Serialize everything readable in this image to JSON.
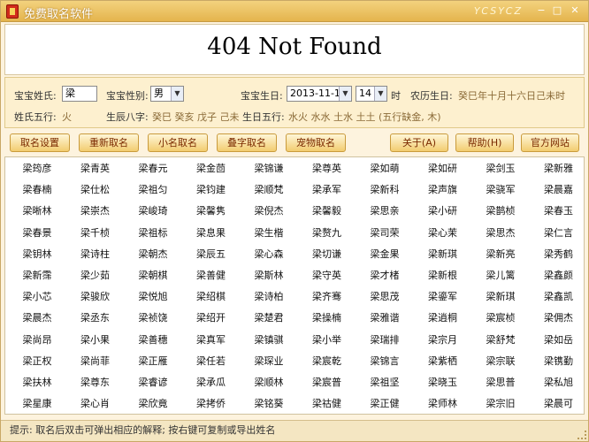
{
  "window": {
    "title": "免费取名软件",
    "brand": "YCSYCZ",
    "minimize": "−",
    "maximize": "□",
    "close": "✕"
  },
  "browser": {
    "message": "404 Not Found"
  },
  "form": {
    "surname_label": "宝宝姓氏:",
    "surname_value": "梁",
    "gender_label": "宝宝性别:",
    "gender_value": "男",
    "birthday_label": "宝宝生日:",
    "birthday_value": "2013-11-18",
    "hour_value": "14",
    "hour_suffix": "时",
    "lunar_label": "农历生日:",
    "lunar_value": "癸巳年十月十六日己未时",
    "surname_wuxing_label": "姓氏五行:",
    "surname_wuxing_value": "火",
    "bazi_label": "生辰八字:",
    "bazi_value": "癸巳 癸亥 戊子 己未",
    "day_wuxing_label": "生日五行:",
    "day_wuxing_value": "水火 水水 土水 土土 (五行缺金, 木)"
  },
  "toolbar": {
    "buttons": [
      "取名设置",
      "重新取名",
      "小名取名",
      "叠字取名",
      "宠物取名",
      "关于(A)",
      "帮助(H)",
      "官方网站"
    ]
  },
  "names": [
    [
      "梁筠彦",
      "梁青英",
      "梁春元",
      "梁金茴",
      "梁锦谦",
      "梁尊英",
      "梁如萌",
      "梁如研",
      "梁剑玉",
      "梁新雅"
    ],
    [
      "梁春楠",
      "梁仕松",
      "梁祖匀",
      "梁钧建",
      "梁顺梵",
      "梁承军",
      "梁新科",
      "梁声旗",
      "梁骁军",
      "梁晨嘉"
    ],
    [
      "梁晰林",
      "梁崇杰",
      "梁峻琦",
      "梁馨隽",
      "梁倪杰",
      "梁馨毅",
      "梁思亲",
      "梁小研",
      "梁鹊桢",
      "梁春玉"
    ],
    [
      "梁春景",
      "梁千桢",
      "梁祖标",
      "梁息果",
      "梁生楷",
      "梁赘九",
      "梁司荣",
      "梁心茉",
      "梁思杰",
      "梁仁言"
    ],
    [
      "梁钥林",
      "梁诗柱",
      "梁朝杰",
      "梁辰五",
      "梁心森",
      "梁切谦",
      "梁金果",
      "梁新琪",
      "梁新亮",
      "梁秀鹤"
    ],
    [
      "梁新霈",
      "梁少茹",
      "梁朝棋",
      "梁善健",
      "梁斯林",
      "梁守英",
      "梁才楮",
      "梁新根",
      "梁儿篱",
      "梁鑫颜"
    ],
    [
      "梁小芯",
      "梁骏欣",
      "梁悦旭",
      "梁绍棋",
      "梁诗柏",
      "梁齐骞",
      "梁思茂",
      "梁鎏军",
      "梁新琪",
      "梁鑫凯"
    ],
    [
      "梁晨杰",
      "梁丞东",
      "梁祯饶",
      "梁绍开",
      "梁楚君",
      "梁操楠",
      "梁雅谐",
      "梁逍桐",
      "梁宸桢",
      "梁佣杰"
    ],
    [
      "梁尚昂",
      "梁小果",
      "梁善穗",
      "梁真军",
      "梁镇骐",
      "梁小举",
      "梁瑞排",
      "梁宗月",
      "梁舒梵",
      "梁如岳"
    ],
    [
      "梁正权",
      "梁尚菲",
      "梁正雁",
      "梁任若",
      "梁琛业",
      "梁宸乾",
      "梁锦言",
      "梁紫栖",
      "梁宗联",
      "梁镌勤"
    ],
    [
      "梁扶林",
      "梁尊东",
      "梁睿谚",
      "梁承瓜",
      "梁顺林",
      "梁宸普",
      "梁祖坚",
      "梁晓玉",
      "梁思普",
      "梁私旭"
    ],
    [
      "梁星康",
      "梁心肖",
      "梁欣竟",
      "梁拷侨",
      "梁铭葵",
      "梁祜健",
      "梁正健",
      "梁师林",
      "梁宗旧",
      "梁晨可"
    ]
  ],
  "status": {
    "text": "提示: 取名后双击可弹出相应的解释; 按右键可复制或导出姓名"
  }
}
